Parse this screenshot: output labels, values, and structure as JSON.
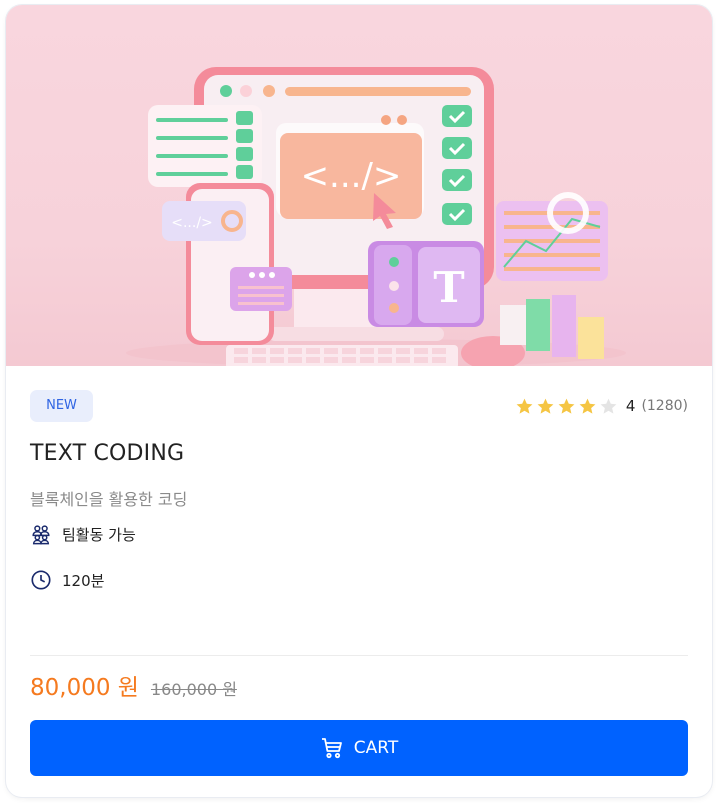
{
  "card": {
    "badge": "NEW",
    "rating": {
      "stars": 4,
      "max_stars": 5,
      "score": "4",
      "count": "(1280)"
    },
    "title": "TEXT CODING",
    "subtitle": "블록체인을 활용한 코딩",
    "features": [
      {
        "icon": "team-icon",
        "label": "팀활동 가능"
      },
      {
        "icon": "clock-icon",
        "label": "120분"
      }
    ],
    "price": {
      "current": "80,000 원",
      "original": "160,000 원"
    },
    "cart_button": {
      "icon": "cart-icon",
      "label": "CART"
    }
  },
  "hero_image": {
    "code_tag": "<.../>",
    "small_code_tag": "<.../>",
    "font_tile_letter": "T"
  },
  "colors": {
    "accent_blue": "#0062ff",
    "price_orange": "#f57a1f",
    "star_yellow": "#f5c543",
    "badge_bg": "#e9eefc",
    "badge_text": "#2f64e3"
  }
}
